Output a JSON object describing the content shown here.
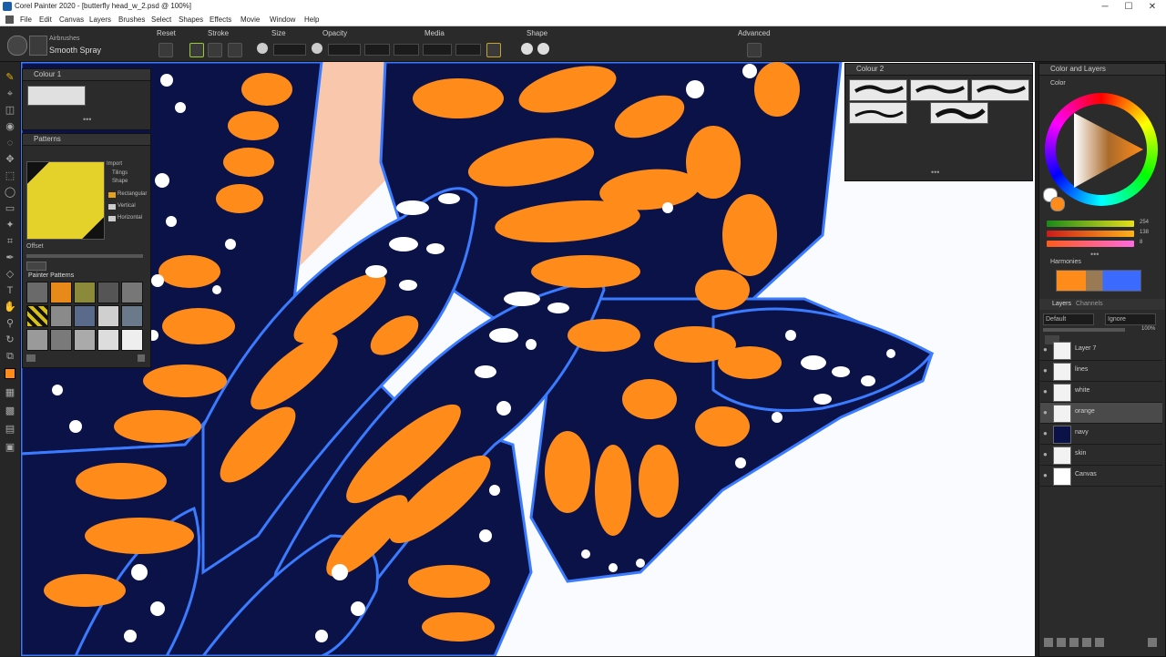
{
  "window": {
    "title": "Corel Painter 2020 - [butterfly head_w_2.psd @ 100%]",
    "minimize": "─",
    "maximize": "☐",
    "close": "✕"
  },
  "menu": [
    "File",
    "Edit",
    "Canvas",
    "Layers",
    "Brushes",
    "Select",
    "Shapes",
    "Effects",
    "Movie",
    "Window",
    "Help"
  ],
  "property_bar": {
    "brush_category": "Airbrushes",
    "brush_variant": "Smooth Spray",
    "groups": [
      "Reset",
      "Stroke",
      "Size",
      "Opacity",
      "Media",
      "Shape",
      "Advanced"
    ]
  },
  "panels": {
    "color_set": {
      "title": "Colour 1"
    },
    "patterns": {
      "title": "Patterns",
      "options": [
        "Import",
        "Tilings",
        "Shape",
        "Rectangular",
        "Vertical",
        "Horizontal"
      ],
      "offset_label": "Offset",
      "library_title": "Painter Patterns"
    },
    "brush_strokes": {
      "title": "Colour 2"
    },
    "color_layers": {
      "title": "Color and Layers",
      "color_tab": "Color",
      "harmonies_label": "Harmonies",
      "slider_values": [
        "254",
        "138",
        "8"
      ]
    },
    "layers": {
      "tabs": [
        "Layers",
        "Channels"
      ],
      "composite_method": "Default",
      "composite_depth": "Ignore",
      "opacity": "100%",
      "items": [
        "Layer 7",
        "lines",
        "white",
        "orange",
        "navy",
        "skin",
        "Canvas"
      ],
      "selected_index": 3
    }
  },
  "colors": {
    "accent_orange": "#ff8c1a",
    "navy": "#0b1247",
    "wing_edge_blue": "#3a7bff",
    "skin": "#f9c7ab",
    "canvas_bg": "#fafbff"
  }
}
